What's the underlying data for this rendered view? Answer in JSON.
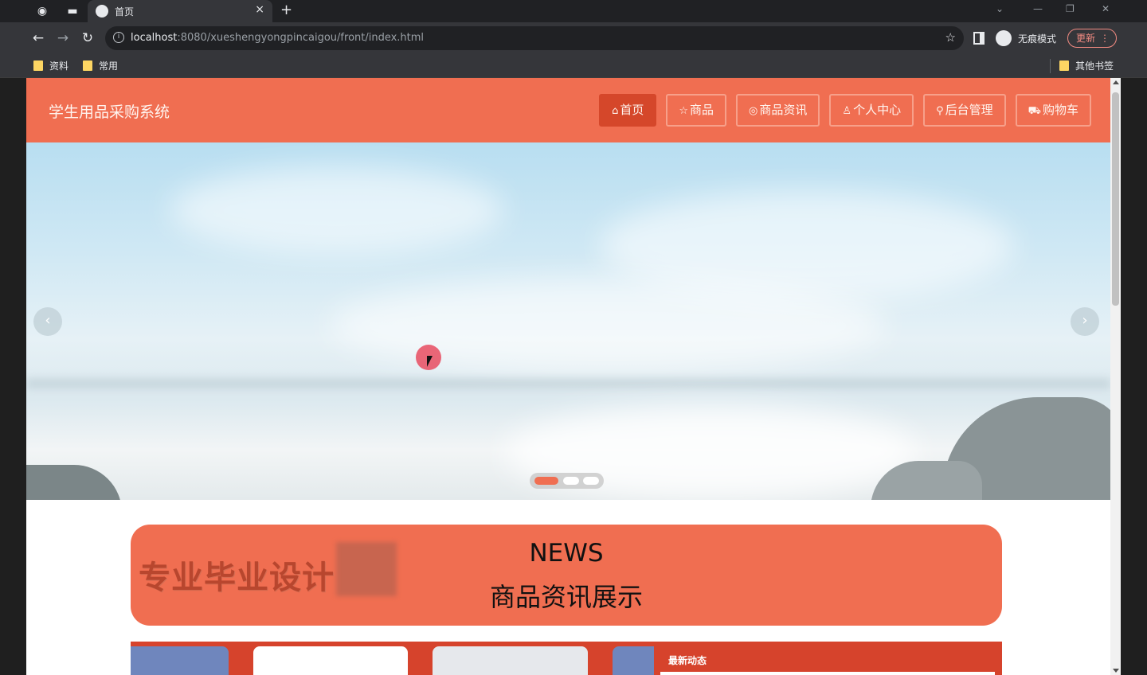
{
  "browser": {
    "tab_title": "首页",
    "url_host": "localhost",
    "url_rest": ":8080/xueshengyongpincaigou/front/index.html",
    "incognito_label": "无痕模式",
    "update_label": "更新",
    "bookmarks": [
      "资料",
      "常用"
    ],
    "other_bookmarks": "其他书签"
  },
  "header": {
    "site_title": "学生用品采购系统",
    "nav": [
      {
        "label": "首页",
        "icon": "home-icon",
        "glyph": "⌂",
        "active": true
      },
      {
        "label": "商品",
        "icon": "star-icon",
        "glyph": "☆",
        "active": false
      },
      {
        "label": "商品资讯",
        "icon": "chat-icon",
        "glyph": "◎",
        "active": false
      },
      {
        "label": "个人中心",
        "icon": "user-icon",
        "glyph": "♙",
        "active": false
      },
      {
        "label": "后台管理",
        "icon": "link-icon",
        "glyph": "⚲",
        "active": false
      },
      {
        "label": "购物车",
        "icon": "cart-icon",
        "glyph": "⛟",
        "active": false
      }
    ]
  },
  "banner": {
    "slide_count": 3,
    "active_slide": 1
  },
  "news_section": {
    "watermark": "专业毕业设计",
    "title_en": "NEWS",
    "title_zh": "商品资讯展示"
  },
  "latest": {
    "label": "最新动态"
  },
  "colors": {
    "accent": "#f06e51",
    "accent_dark": "#d5472a"
  }
}
